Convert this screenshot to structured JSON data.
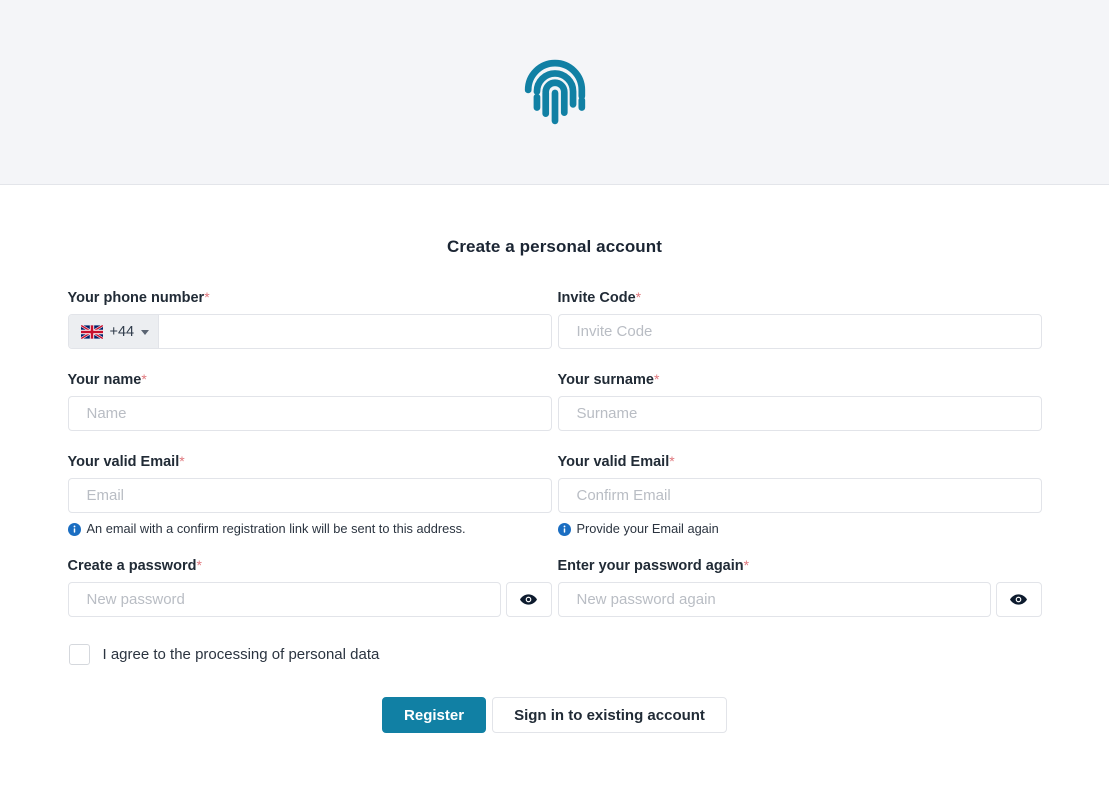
{
  "header": {
    "logo_icon": "fingerprint-icon",
    "logo_color": "#1180a4",
    "background": "#f4f5f8"
  },
  "page": {
    "title": "Create a personal account"
  },
  "form": {
    "phone": {
      "label": "Your phone number",
      "required_mark": "*",
      "country_flag": "uk-flag-icon",
      "dial_code": "+44",
      "caret_icon": "chevron-down-icon",
      "value": ""
    },
    "invite": {
      "label": "Invite Code",
      "required_mark": "*",
      "placeholder": "Invite Code",
      "value": ""
    },
    "name": {
      "label": "Your name",
      "required_mark": "*",
      "placeholder": "Name",
      "value": ""
    },
    "surname": {
      "label": "Your surname",
      "required_mark": "*",
      "placeholder": "Surname",
      "value": ""
    },
    "email": {
      "label": "Your valid Email",
      "required_mark": "*",
      "placeholder": "Email",
      "value": "",
      "hint": "An email with a confirm registration link will be sent to this address.",
      "hint_icon": "info-icon"
    },
    "email_confirm": {
      "label": "Your valid Email",
      "required_mark": "*",
      "placeholder": "Confirm Email",
      "value": "",
      "hint": "Provide your Email again",
      "hint_icon": "info-icon"
    },
    "password": {
      "label": "Create a password",
      "required_mark": "*",
      "placeholder": "New password",
      "value": "",
      "toggle_icon": "eye-icon"
    },
    "password_confirm": {
      "label": "Enter your password again",
      "required_mark": "*",
      "placeholder": "New password again",
      "value": "",
      "toggle_icon": "eye-icon"
    },
    "consent": {
      "label": "I agree to the processing of personal data",
      "checked": false
    }
  },
  "actions": {
    "register_label": "Register",
    "signin_label": "Sign in to existing account",
    "primary_color": "#1180a4"
  }
}
